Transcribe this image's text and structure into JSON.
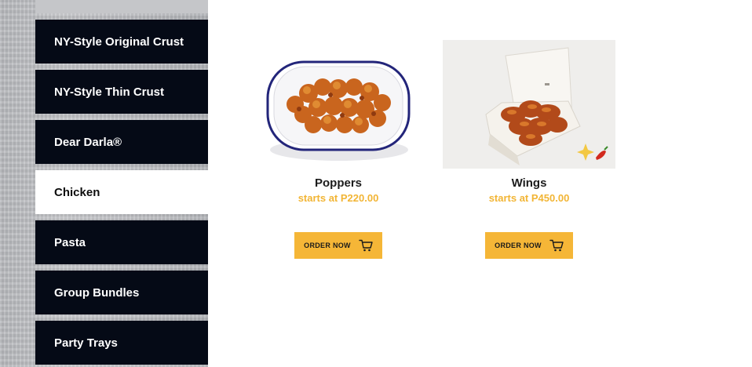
{
  "sidebar": {
    "items": [
      {
        "label": "NY-Style Original Crust",
        "active": false
      },
      {
        "label": "NY-Style Thin Crust",
        "active": false
      },
      {
        "label": "Dear Darla®",
        "active": false
      },
      {
        "label": "Chicken",
        "active": true
      },
      {
        "label": "Pasta",
        "active": false
      },
      {
        "label": "Group Bundles",
        "active": false
      },
      {
        "label": "Party Trays",
        "active": false
      }
    ]
  },
  "products": [
    {
      "name": "Poppers",
      "price": "starts at P220.00",
      "button": "ORDER NOW",
      "image_icon": "poppers-bowl-image"
    },
    {
      "name": "Wings",
      "price": "starts at P450.00",
      "button": "ORDER NOW",
      "image_icon": "wings-box-image"
    }
  ],
  "colors": {
    "nav_bg": "#050a16",
    "accent": "#f5b637",
    "price": "#f2b535"
  }
}
